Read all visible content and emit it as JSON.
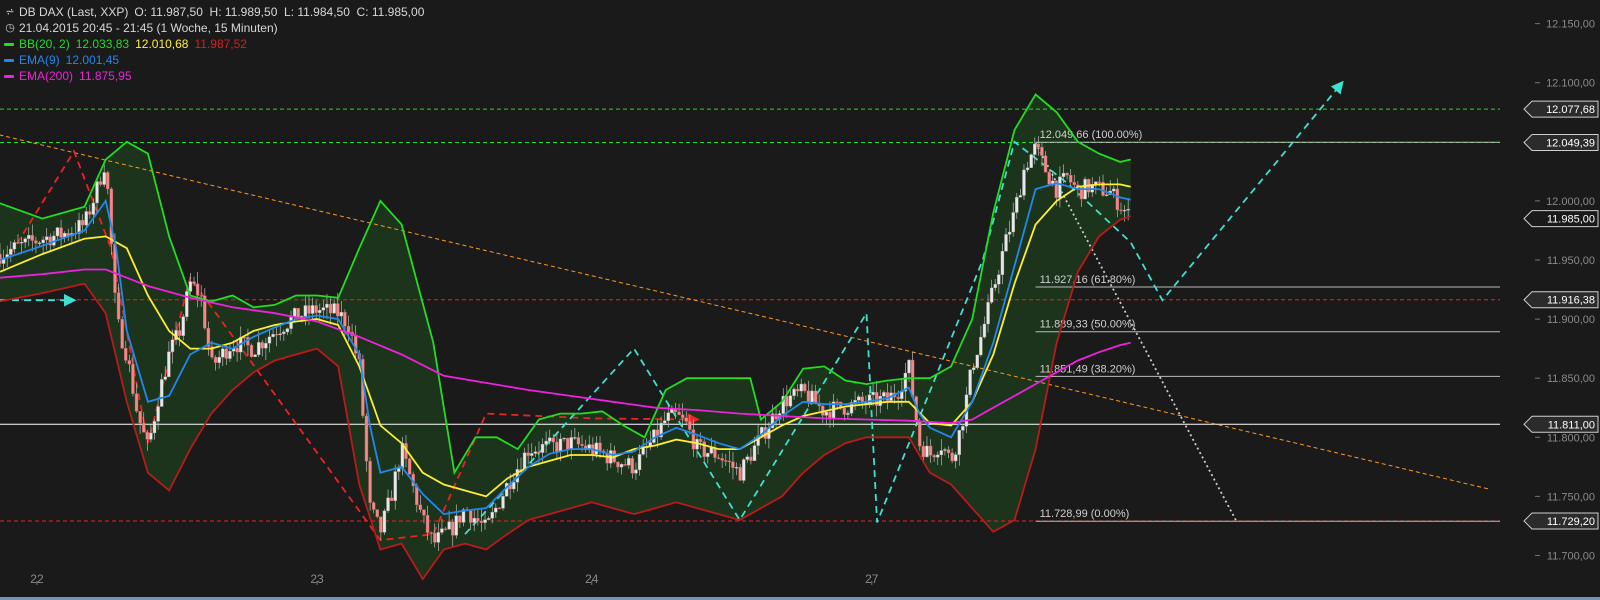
{
  "header": {
    "instrument": "DB DAX (Last, XXP)",
    "ohlc": "O: 11.987,50  H: 11.989,50  L: 11.984,50  C: 11.985,00",
    "period": "21.04.2015 20:45 - 21:45 (1 Woche, 15 Minuten)"
  },
  "indicators": [
    {
      "name": "BB(20, 2)",
      "color": "#22dd22",
      "values": [
        {
          "text": "12.033,83",
          "color": "#22dd22"
        },
        {
          "text": "12.010,68",
          "color": "#ffee33"
        },
        {
          "text": "11.987,52",
          "color": "#cc2222"
        }
      ]
    },
    {
      "name": "EMA(9)",
      "color": "#2288ee",
      "values": [
        {
          "text": "12.001,45",
          "color": "#2288ee"
        }
      ]
    },
    {
      "name": "EMA(200)",
      "color": "#ee22dd",
      "values": [
        {
          "text": "11.875,95",
          "color": "#ee22dd"
        }
      ]
    }
  ],
  "chart_data": {
    "type": "candlestick",
    "title": "DB DAX (Last, XXP)",
    "ylim": [
      11675,
      12170
    ],
    "y_ticks": [
      11700,
      11750,
      11800,
      11850,
      11900,
      11950,
      12000,
      12050,
      12100,
      12150
    ],
    "y_tick_labels": [
      "11.700,00",
      "11.750,00",
      "11.800,00",
      "11.850,00",
      "11.900,00",
      "11.950,00",
      "12.000,00",
      "12.050,00",
      "12.100,00",
      "12.150,00"
    ],
    "x_days": [
      {
        "label": "22",
        "index": 3.5
      },
      {
        "label": "23",
        "index": 30
      },
      {
        "label": "24",
        "index": 56
      },
      {
        "label": "27",
        "index": 82.5
      }
    ],
    "x_range": [
      0,
      141
    ],
    "close_path": [
      [
        0,
        11955
      ],
      [
        2,
        11962
      ],
      [
        4,
        11968
      ],
      [
        6,
        11972
      ],
      [
        8,
        11980
      ],
      [
        9,
        12005
      ],
      [
        10,
        12035
      ],
      [
        11,
        11900
      ],
      [
        12,
        11870
      ],
      [
        13,
        11820
      ],
      [
        14,
        11790
      ],
      [
        15,
        11835
      ],
      [
        16,
        11870
      ],
      [
        17,
        11890
      ],
      [
        18,
        11930
      ],
      [
        19,
        11920
      ],
      [
        20,
        11860
      ],
      [
        22,
        11880
      ],
      [
        24,
        11875
      ],
      [
        26,
        11890
      ],
      [
        28,
        11902
      ],
      [
        30,
        11908
      ],
      [
        32,
        11905
      ],
      [
        33,
        11895
      ],
      [
        34,
        11860
      ],
      [
        35,
        11740
      ],
      [
        36,
        11720
      ],
      [
        37,
        11750
      ],
      [
        38,
        11790
      ],
      [
        40,
        11730
      ],
      [
        41,
        11710
      ],
      [
        43,
        11725
      ],
      [
        44,
        11740
      ],
      [
        46,
        11722
      ],
      [
        48,
        11760
      ],
      [
        50,
        11790
      ],
      [
        52,
        11792
      ],
      [
        54,
        11795
      ],
      [
        56,
        11790
      ],
      [
        58,
        11782
      ],
      [
        60,
        11775
      ],
      [
        62,
        11800
      ],
      [
        63,
        11815
      ],
      [
        64,
        11818
      ],
      [
        65,
        11810
      ],
      [
        66,
        11790
      ],
      [
        68,
        11785
      ],
      [
        70,
        11770
      ],
      [
        72,
        11800
      ],
      [
        74,
        11830
      ],
      [
        76,
        11838
      ],
      [
        78,
        11822
      ],
      [
        80,
        11826
      ],
      [
        82,
        11830
      ],
      [
        84,
        11832
      ],
      [
        85,
        11840
      ],
      [
        86,
        11860
      ],
      [
        87,
        11795
      ],
      [
        88,
        11785
      ],
      [
        89,
        11795
      ],
      [
        90,
        11780
      ],
      [
        91,
        11810
      ],
      [
        92,
        11860
      ],
      [
        93,
        11890
      ],
      [
        94,
        11925
      ],
      [
        95,
        11960
      ],
      [
        96,
        11990
      ],
      [
        97,
        12030
      ],
      [
        98,
        12045
      ],
      [
        99,
        12025
      ],
      [
        100,
        12010
      ],
      [
        101,
        12020
      ],
      [
        102,
        12008
      ],
      [
        103,
        12012
      ],
      [
        104,
        12010
      ],
      [
        105,
        12008
      ],
      [
        106,
        11997
      ],
      [
        107,
        11985
      ]
    ],
    "bb_upper": [
      [
        0,
        11998
      ],
      [
        4,
        11985
      ],
      [
        8,
        11995
      ],
      [
        10,
        12035
      ],
      [
        12,
        12050
      ],
      [
        14,
        12040
      ],
      [
        16,
        11970
      ],
      [
        18,
        11920
      ],
      [
        20,
        11915
      ],
      [
        22,
        11920
      ],
      [
        24,
        11910
      ],
      [
        26,
        11912
      ],
      [
        28,
        11920
      ],
      [
        30,
        11920
      ],
      [
        32,
        11918
      ],
      [
        34,
        11960
      ],
      [
        36,
        12000
      ],
      [
        38,
        11980
      ],
      [
        41,
        11880
      ],
      [
        43,
        11770
      ],
      [
        45,
        11800
      ],
      [
        47,
        11800
      ],
      [
        49,
        11790
      ],
      [
        51,
        11815
      ],
      [
        53,
        11820
      ],
      [
        55,
        11820
      ],
      [
        57,
        11822
      ],
      [
        59,
        11810
      ],
      [
        61,
        11800
      ],
      [
        63,
        11840
      ],
      [
        65,
        11850
      ],
      [
        67,
        11850
      ],
      [
        69,
        11850
      ],
      [
        71,
        11850
      ],
      [
        72,
        11815
      ],
      [
        74,
        11830
      ],
      [
        76,
        11858
      ],
      [
        78,
        11860
      ],
      [
        80,
        11848
      ],
      [
        82,
        11845
      ],
      [
        84,
        11848
      ],
      [
        86,
        11850
      ],
      [
        88,
        11850
      ],
      [
        90,
        11860
      ],
      [
        92,
        11900
      ],
      [
        94,
        11990
      ],
      [
        96,
        12060
      ],
      [
        98,
        12090
      ],
      [
        100,
        12075
      ],
      [
        102,
        12050
      ],
      [
        104,
        12040
      ],
      [
        106,
        12033
      ],
      [
        107,
        12035
      ]
    ],
    "bb_middle": [
      [
        0,
        11940
      ],
      [
        4,
        11955
      ],
      [
        8,
        11968
      ],
      [
        10,
        11970
      ],
      [
        12,
        11960
      ],
      [
        14,
        11920
      ],
      [
        16,
        11890
      ],
      [
        18,
        11875
      ],
      [
        20,
        11875
      ],
      [
        22,
        11880
      ],
      [
        24,
        11890
      ],
      [
        26,
        11895
      ],
      [
        28,
        11898
      ],
      [
        30,
        11900
      ],
      [
        32,
        11895
      ],
      [
        34,
        11860
      ],
      [
        36,
        11810
      ],
      [
        38,
        11795
      ],
      [
        40,
        11770
      ],
      [
        42,
        11760
      ],
      [
        44,
        11755
      ],
      [
        46,
        11750
      ],
      [
        48,
        11765
      ],
      [
        50,
        11775
      ],
      [
        52,
        11780
      ],
      [
        54,
        11785
      ],
      [
        56,
        11785
      ],
      [
        58,
        11783
      ],
      [
        60,
        11790
      ],
      [
        62,
        11793
      ],
      [
        64,
        11798
      ],
      [
        66,
        11795
      ],
      [
        68,
        11790
      ],
      [
        70,
        11790
      ],
      [
        72,
        11800
      ],
      [
        74,
        11810
      ],
      [
        76,
        11818
      ],
      [
        78,
        11822
      ],
      [
        80,
        11826
      ],
      [
        82,
        11828
      ],
      [
        84,
        11830
      ],
      [
        86,
        11830
      ],
      [
        88,
        11812
      ],
      [
        90,
        11810
      ],
      [
        92,
        11830
      ],
      [
        94,
        11870
      ],
      [
        96,
        11930
      ],
      [
        98,
        11980
      ],
      [
        100,
        12000
      ],
      [
        102,
        12012
      ],
      [
        104,
        12014
      ],
      [
        106,
        12014
      ],
      [
        107,
        12012
      ]
    ],
    "bb_lower": [
      [
        0,
        11915
      ],
      [
        4,
        11922
      ],
      [
        8,
        11930
      ],
      [
        10,
        11905
      ],
      [
        12,
        11830
      ],
      [
        14,
        11770
      ],
      [
        16,
        11755
      ],
      [
        18,
        11790
      ],
      [
        20,
        11820
      ],
      [
        22,
        11840
      ],
      [
        24,
        11855
      ],
      [
        26,
        11865
      ],
      [
        28,
        11870
      ],
      [
        30,
        11875
      ],
      [
        32,
        11860
      ],
      [
        34,
        11760
      ],
      [
        36,
        11705
      ],
      [
        38,
        11710
      ],
      [
        40,
        11680
      ],
      [
        42,
        11705
      ],
      [
        44,
        11710
      ],
      [
        46,
        11705
      ],
      [
        48,
        11718
      ],
      [
        50,
        11730
      ],
      [
        52,
        11735
      ],
      [
        54,
        11740
      ],
      [
        56,
        11745
      ],
      [
        58,
        11740
      ],
      [
        60,
        11735
      ],
      [
        62,
        11740
      ],
      [
        64,
        11745
      ],
      [
        66,
        11740
      ],
      [
        68,
        11735
      ],
      [
        70,
        11730
      ],
      [
        72,
        11740
      ],
      [
        74,
        11750
      ],
      [
        76,
        11770
      ],
      [
        78,
        11785
      ],
      [
        80,
        11795
      ],
      [
        82,
        11800
      ],
      [
        84,
        11800
      ],
      [
        86,
        11800
      ],
      [
        88,
        11770
      ],
      [
        90,
        11760
      ],
      [
        92,
        11740
      ],
      [
        94,
        11720
      ],
      [
        96,
        11730
      ],
      [
        98,
        11790
      ],
      [
        100,
        11880
      ],
      [
        102,
        11940
      ],
      [
        104,
        11970
      ],
      [
        106,
        11984
      ],
      [
        107,
        11987
      ]
    ],
    "ema9": [
      [
        0,
        11950
      ],
      [
        4,
        11962
      ],
      [
        8,
        11975
      ],
      [
        10,
        12000
      ],
      [
        11,
        11960
      ],
      [
        12,
        11890
      ],
      [
        14,
        11830
      ],
      [
        16,
        11835
      ],
      [
        18,
        11870
      ],
      [
        20,
        11880
      ],
      [
        22,
        11875
      ],
      [
        24,
        11885
      ],
      [
        26,
        11893
      ],
      [
        28,
        11900
      ],
      [
        30,
        11903
      ],
      [
        32,
        11900
      ],
      [
        34,
        11870
      ],
      [
        35,
        11810
      ],
      [
        36,
        11770
      ],
      [
        38,
        11775
      ],
      [
        40,
        11752
      ],
      [
        42,
        11735
      ],
      [
        44,
        11738
      ],
      [
        46,
        11740
      ],
      [
        48,
        11758
      ],
      [
        50,
        11775
      ],
      [
        52,
        11786
      ],
      [
        54,
        11790
      ],
      [
        56,
        11790
      ],
      [
        58,
        11785
      ],
      [
        60,
        11788
      ],
      [
        62,
        11800
      ],
      [
        64,
        11808
      ],
      [
        66,
        11802
      ],
      [
        68,
        11795
      ],
      [
        70,
        11790
      ],
      [
        72,
        11802
      ],
      [
        74,
        11818
      ],
      [
        76,
        11830
      ],
      [
        78,
        11828
      ],
      [
        80,
        11828
      ],
      [
        82,
        11830
      ],
      [
        84,
        11833
      ],
      [
        86,
        11842
      ],
      [
        87,
        11820
      ],
      [
        88,
        11808
      ],
      [
        90,
        11800
      ],
      [
        92,
        11830
      ],
      [
        94,
        11880
      ],
      [
        96,
        11945
      ],
      [
        98,
        12010
      ],
      [
        100,
        12015
      ],
      [
        102,
        12010
      ],
      [
        104,
        12010
      ],
      [
        106,
        12003
      ],
      [
        107,
        12001
      ]
    ],
    "ema200": [
      [
        0,
        11935
      ],
      [
        4,
        11938
      ],
      [
        8,
        11942
      ],
      [
        10,
        11942
      ],
      [
        14,
        11928
      ],
      [
        18,
        11918
      ],
      [
        22,
        11910
      ],
      [
        26,
        11905
      ],
      [
        30,
        11898
      ],
      [
        34,
        11885
      ],
      [
        38,
        11870
      ],
      [
        42,
        11852
      ],
      [
        46,
        11846
      ],
      [
        50,
        11840
      ],
      [
        54,
        11835
      ],
      [
        58,
        11830
      ],
      [
        62,
        11825
      ],
      [
        66,
        11823
      ],
      [
        70,
        11820
      ],
      [
        74,
        11818
      ],
      [
        78,
        11816
      ],
      [
        82,
        11815
      ],
      [
        86,
        11814
      ],
      [
        90,
        11812
      ],
      [
        92,
        11815
      ],
      [
        94,
        11825
      ],
      [
        96,
        11835
      ],
      [
        98,
        11845
      ],
      [
        100,
        11855
      ],
      [
        102,
        11865
      ],
      [
        104,
        11872
      ],
      [
        106,
        11878
      ],
      [
        107,
        11880
      ]
    ],
    "horizontal_levels": [
      {
        "value": 12077.68,
        "label": "12.077,68",
        "style": "dashed",
        "color": "#22dd22"
      },
      {
        "value": 12049.39,
        "label": "12.049,39",
        "style": "dashed",
        "color": "#22dd22"
      },
      {
        "value": 11985.0,
        "label": "11.985,00",
        "style": "current",
        "color": "#ffffff"
      },
      {
        "value": 11916.38,
        "label": "11.916,38",
        "style": "dashed",
        "color": "#ee2222"
      },
      {
        "value": 11811.0,
        "label": "11.811,00",
        "style": "solid",
        "color": "#ffffff"
      },
      {
        "value": 11729.2,
        "label": "11.729,20",
        "style": "dashed",
        "color": "#ee2222"
      }
    ],
    "fibonacci": [
      {
        "value": 12049.66,
        "label": "12.049,66 (100.00%)"
      },
      {
        "value": 11927.16,
        "label": "11.927,16 (61.80%)"
      },
      {
        "value": 11889.33,
        "label": "11.889,33 (50.00%)"
      },
      {
        "value": 11851.49,
        "label": "11.851,49 (38.20%)"
      },
      {
        "value": 11728.99,
        "label": "11.728,99 (0.00%)"
      }
    ],
    "fib_start_index": 98,
    "trendlines": [
      {
        "color": "#ff9922",
        "style": "dashed",
        "points": [
          [
            -2,
            12060
          ],
          [
            141,
            11756
          ]
        ]
      },
      {
        "color": "#ee2222",
        "style": "dashed",
        "points": [
          [
            1,
            11955
          ],
          [
            7,
            12042
          ],
          [
            10.5,
            11960
          ],
          [
            14,
            11795
          ],
          [
            18,
            11935
          ],
          [
            36,
            11713
          ],
          [
            41,
            11718
          ],
          [
            46,
            11820
          ],
          [
            56,
            11816
          ],
          [
            66,
            11815
          ]
        ],
        "arrow_end": true
      },
      {
        "color": "#40e0d0",
        "style": "dashed",
        "points": [
          [
            0,
            11916
          ],
          [
            7,
            11916
          ]
        ],
        "arrow_end": true
      },
      {
        "color": "#40e0d0",
        "style": "dashed",
        "points": [
          [
            44,
            11718
          ],
          [
            60,
            11875
          ],
          [
            70,
            11730
          ],
          [
            82,
            11905
          ],
          [
            83,
            11728
          ],
          [
            93,
            11950
          ],
          [
            96,
            12050
          ],
          [
            101,
            12015
          ],
          [
            107,
            11965
          ],
          [
            110,
            11916
          ],
          [
            127,
            12100
          ]
        ],
        "arrow_end": true
      },
      {
        "color": "#cccccc",
        "style": "dotted",
        "points": [
          [
            98,
            12049
          ],
          [
            117,
            11729
          ]
        ]
      }
    ]
  }
}
